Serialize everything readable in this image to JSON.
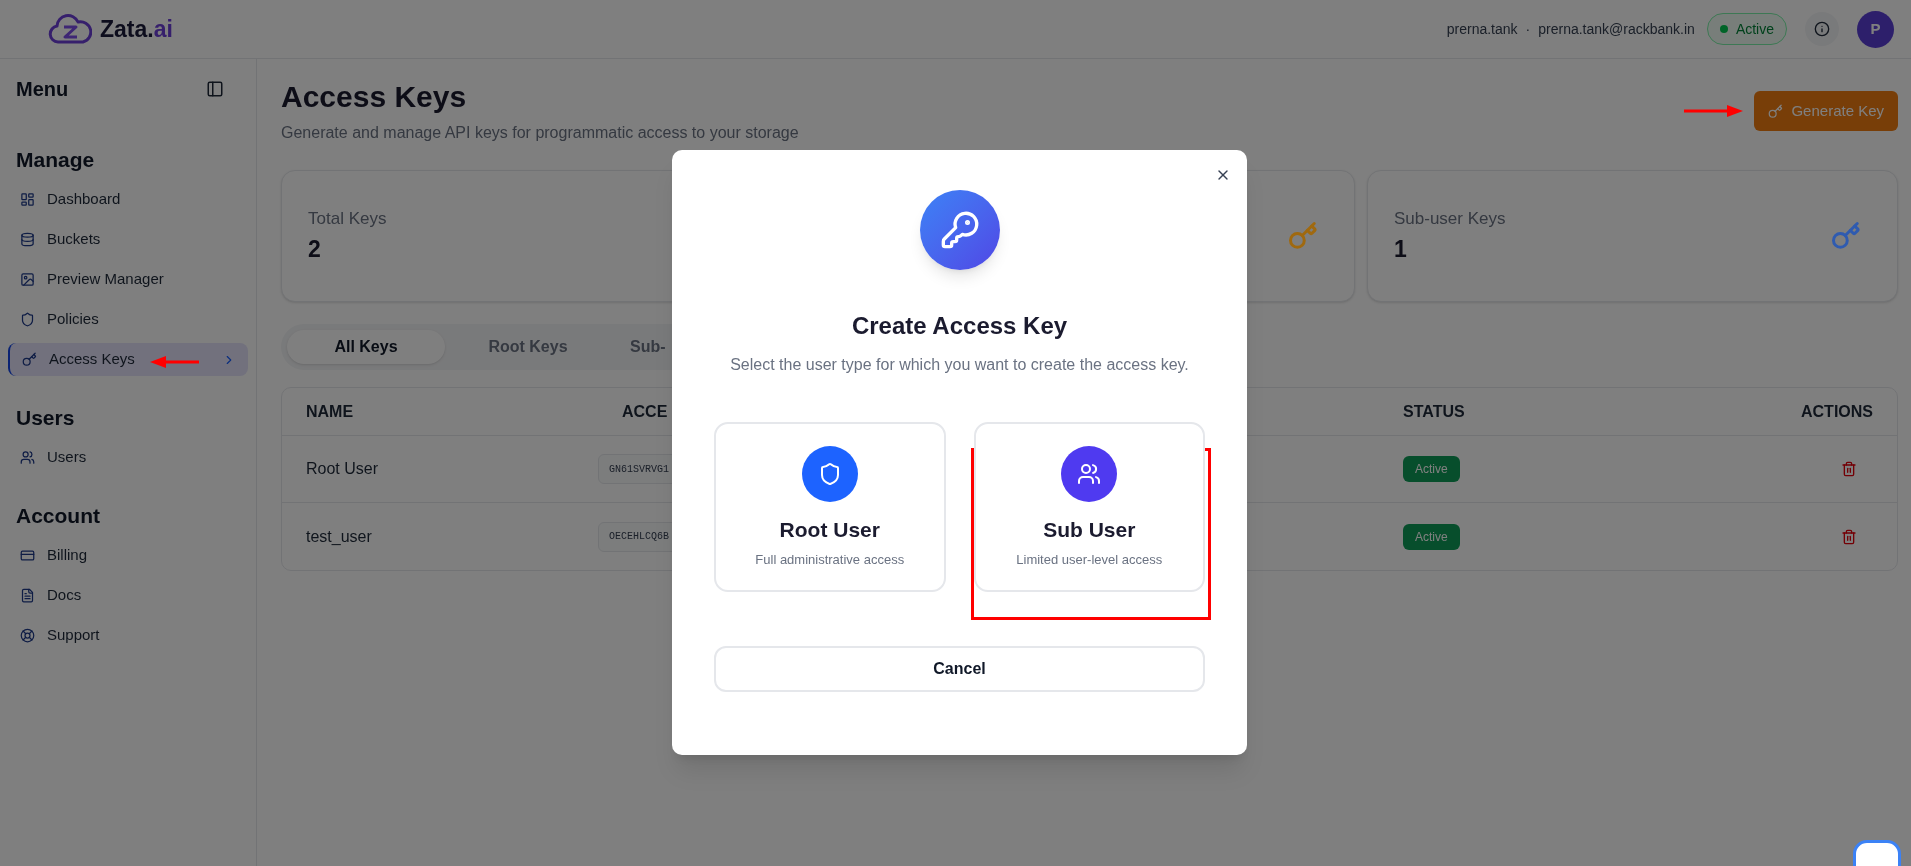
{
  "header": {
    "brand": "Zata.",
    "brand_suffix": "ai",
    "username": "prerna.tank",
    "separator": "·",
    "email": "prerna.tank@rackbank.in",
    "status": "Active",
    "avatar": "P"
  },
  "sidebar": {
    "title": "Menu",
    "sections": [
      {
        "heading": "Manage",
        "items": [
          {
            "label": "Dashboard",
            "selected": false
          },
          {
            "label": "Buckets",
            "selected": false
          },
          {
            "label": "Preview Manager",
            "selected": false
          },
          {
            "label": "Policies",
            "selected": false
          },
          {
            "label": "Access Keys",
            "selected": true
          }
        ]
      },
      {
        "heading": "Users",
        "items": [
          {
            "label": "Users",
            "selected": false
          }
        ]
      },
      {
        "heading": "Account",
        "items": [
          {
            "label": "Billing",
            "selected": false
          },
          {
            "label": "Docs",
            "selected": false
          },
          {
            "label": "Support",
            "selected": false
          }
        ]
      }
    ]
  },
  "page": {
    "title": "Access Keys",
    "subtitle": "Generate and manage API keys for programmatic access to your storage",
    "generate_button": "Generate Key"
  },
  "stats": [
    {
      "label": "Total Keys",
      "value": "2"
    },
    {
      "color": "#a0690f"
    },
    {
      "label": "Sub-user Keys",
      "value": "1",
      "color": "#2f5bb0"
    }
  ],
  "tabs": [
    {
      "label": "All Keys",
      "selected": true
    },
    {
      "label": "Root Keys",
      "selected": false
    },
    {
      "label": "Sub-",
      "selected": false
    }
  ],
  "table": {
    "columns": [
      "NAME",
      "ACCE",
      "STATUS",
      "ACTIONS"
    ],
    "rows": [
      {
        "name": "Root User",
        "access_key": "GN61SVRVG1",
        "status": "Active"
      },
      {
        "name": "test_user",
        "access_key": "OECEHLCQ6B",
        "status": "Active"
      }
    ]
  },
  "modal": {
    "title": "Create Access Key",
    "description": "Select the user type for which you want to create the access key.",
    "options": [
      {
        "title": "Root User",
        "subtitle": "Full administrative access",
        "color": "#1d63ff",
        "highlighted": false
      },
      {
        "title": "Sub User",
        "subtitle": "Limited user-level access",
        "color": "#4f3af0",
        "highlighted": true
      }
    ],
    "cancel": "Cancel"
  }
}
